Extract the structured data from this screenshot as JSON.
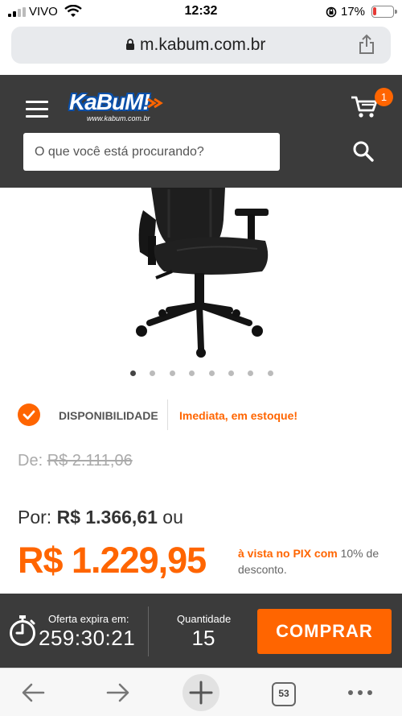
{
  "status_bar": {
    "carrier": "VIVO",
    "time": "12:32",
    "battery": "17%",
    "battery_level": 0.17
  },
  "browser": {
    "url": "m.kabum.com.br",
    "tabs_count": "53"
  },
  "header": {
    "logo_text": "KaBuM!",
    "logo_subtext": "www.kabum.com.br",
    "cart_count": "1",
    "search_placeholder": "O que você está procurando?"
  },
  "gallery": {
    "image_count": 8,
    "active_index": 0
  },
  "availability": {
    "label": "DISPONIBILIDADE",
    "value": "Imediata, em estoque!"
  },
  "pricing": {
    "de_label": "De:",
    "old_price": "R$ 2.111,06",
    "por_label": "Por:",
    "installment_price": "R$ 1.366,61",
    "ou": "ou",
    "pix_price": "R$ 1.229,95",
    "pix_text": "à vista no PIX com",
    "pix_discount": "10%",
    "pix_suffix": "de desconto."
  },
  "purchase_bar": {
    "offer_label": "Oferta expira em:",
    "offer_timer": "259:30:21",
    "quantity_label": "Quantidade",
    "quantity_value": "15",
    "buy_label": "COMPRAR"
  },
  "colors": {
    "brand_orange": "#ff6500",
    "header_dark": "#3b3b3b",
    "logo_blue": "#0b4fa8"
  }
}
